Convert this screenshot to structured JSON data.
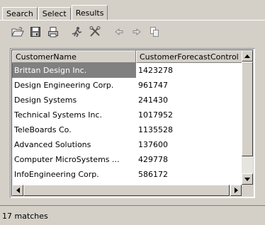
{
  "tabs": [
    {
      "label": "Search",
      "active": false
    },
    {
      "label": "Select",
      "active": false
    },
    {
      "label": "Results",
      "active": true
    }
  ],
  "toolbar": {
    "buttons": [
      {
        "icon": "open-folder-icon"
      },
      {
        "icon": "save-icon"
      },
      {
        "icon": "print-preview-icon"
      },
      {
        "icon": "run-icon"
      },
      {
        "icon": "tools-icon"
      },
      {
        "icon": "back-arrow-icon"
      },
      {
        "icon": "forward-arrow-icon"
      },
      {
        "icon": "copy-icon"
      }
    ]
  },
  "table": {
    "columns": [
      "CustomerName",
      "CustomerForecastControl"
    ],
    "rows": [
      [
        "Brittan Design Inc.",
        "1423278"
      ],
      [
        "Design Engineering Corp.",
        "961747"
      ],
      [
        "Design Systems",
        "241430"
      ],
      [
        "Technical Systems Inc.",
        "1017952"
      ],
      [
        "TeleBoards Co.",
        "1135528"
      ],
      [
        "Advanced Solutions",
        "137600"
      ],
      [
        "Computer MicroSystems ...",
        "429778"
      ],
      [
        "InfoEngineering Corp.",
        "586172"
      ]
    ],
    "selected_row": 0
  },
  "status": {
    "text": "17 matches"
  },
  "colors": {
    "selection": "#808080",
    "face": "#d4d0c8"
  }
}
